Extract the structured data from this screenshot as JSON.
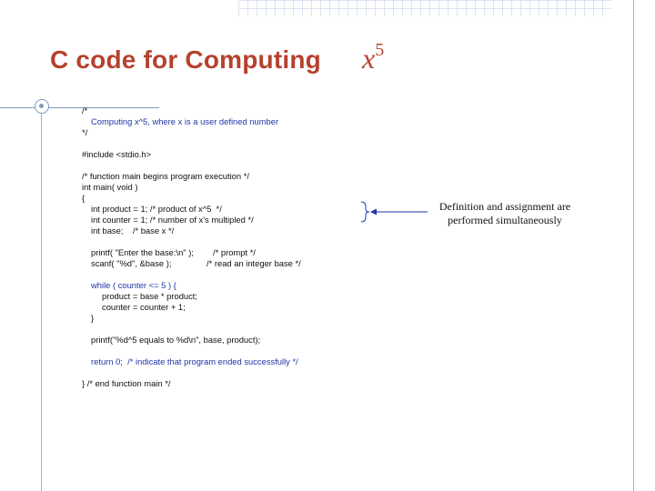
{
  "title": {
    "text": "C code for Computing",
    "math_base": "x",
    "math_exp": "5"
  },
  "code": {
    "c1": "/*",
    "c2": "Computing x^5, where x is a user defined number",
    "c3": "*/",
    "inc": "#include <stdio.h>",
    "fc": "/* function main begins program execution */",
    "main": "int main( void )",
    "ob": "{",
    "d1": "int product = 1; /* product of x^5  */",
    "d2": "int counter = 1; /* number of x's multipled */",
    "d3": "int base;    /* base x */",
    "p1": "printf( \"Enter the base:\\n\" );",
    "p1c": "/* prompt */",
    "s1": "scanf( \"%d\", &base );",
    "s1c": "/* read an integer base */",
    "w1": "while ( counter <= 5 ) {",
    "w2": "product = base * product;",
    "w3": "counter = counter + 1;",
    "w4": "}",
    "pr": "printf(\"%d^5 equals to %d\\n\", base, product);",
    "ret": "return 0;  /* indicate that program ended successfully */",
    "end": "} /* end function main */"
  },
  "annotation": {
    "line1": "Definition and assignment are",
    "line2": "performed simultaneously"
  },
  "colors": {
    "title": "#b5422e",
    "code_highlight": "#1f35a8",
    "decor": "#7f9cc0"
  }
}
